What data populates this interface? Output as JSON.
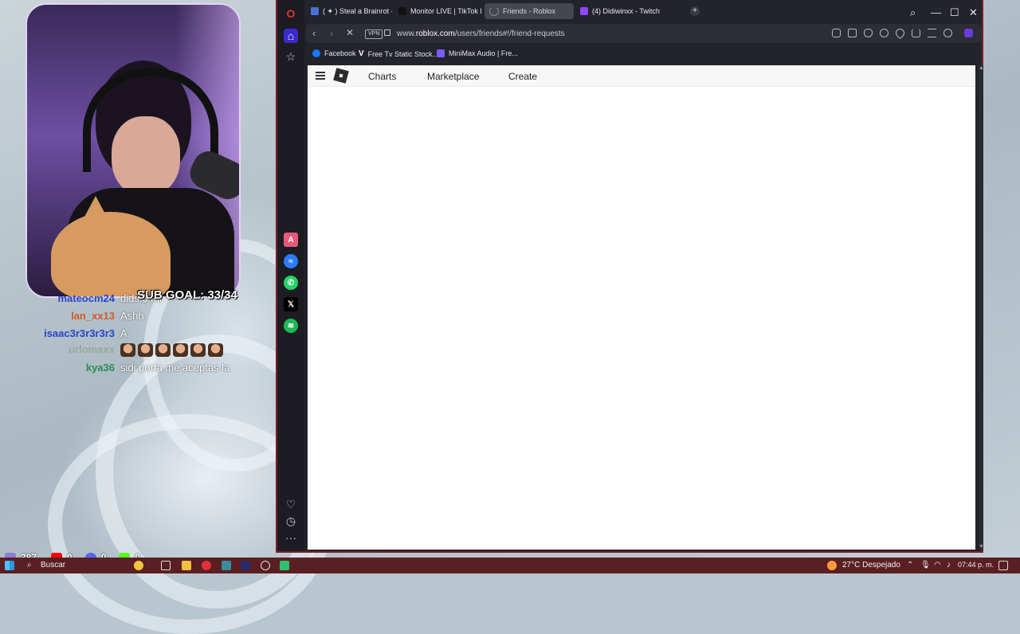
{
  "stream": {
    "sub_goal": "SUB GOAL: 33/34",
    "chat": [
      {
        "user": "mateocm24",
        "user_color": "#2a44c8",
        "message": "dids:3 mi"
      },
      {
        "user": "lan_xx13",
        "user_color": "#d35a2a",
        "message": "Ashh"
      },
      {
        "user": "isaac3r3r3r3r3",
        "user_color": "#2a44c8",
        "message": "A"
      },
      {
        "user": "urlomaxx",
        "user_color": "#9aa8a0",
        "message": "",
        "emote_count": 6
      },
      {
        "user": "kya36",
        "user_color": "#2e8a55",
        "message": "sidi porfa me aceptas la"
      }
    ],
    "stats": {
      "viewers": "387",
      "youtube": "0",
      "discord": "0",
      "kick": "0"
    }
  },
  "browser": {
    "tabs": [
      {
        "label": "( ✦ ) Steal a Brainrot - Rob",
        "favicon_color": "#4a6fd8",
        "active": false
      },
      {
        "label": "Monitor LIVE | TikTok LIVE",
        "favicon_color": "#111111",
        "active": false
      },
      {
        "label": "Friends - Roblox",
        "favicon_color": "#8a8a94",
        "active": true
      },
      {
        "label": "(4) Didiwinxx - Twitch",
        "favicon_color": "#9146ff",
        "active": false
      }
    ],
    "address": {
      "vpn": "VPN",
      "url_prefix": "www.",
      "url_domain": "roblox.com",
      "url_path": "/users/friends#!/friend-requests"
    },
    "bookmarks": [
      {
        "label": "Facebook",
        "color": "#1877f2"
      },
      {
        "label": "Free Tv Static Stock...",
        "color": "#ffffff"
      },
      {
        "label": "MiniMax Audio | Fre...",
        "color": "#7b5cff"
      }
    ],
    "site_nav": {
      "charts": "Charts",
      "marketplace": "Marketplace",
      "create": "Create"
    }
  },
  "taskbar": {
    "search": "Buscar",
    "weather": "27°C  Despejado",
    "time": "07:44 p. m."
  }
}
